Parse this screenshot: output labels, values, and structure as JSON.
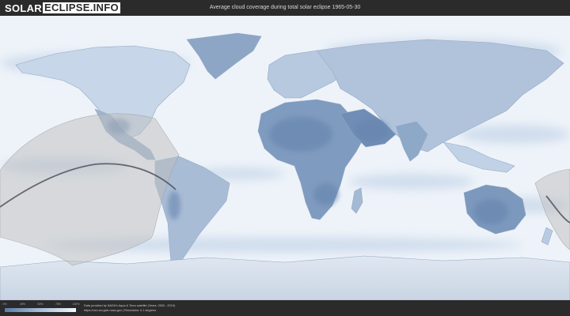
{
  "header": {
    "logo_solar": "SOLAR",
    "logo_eclipse": "ECLIPSE.INFO",
    "title": "Average cloud coverage during total solar eclipse 1965-05-30"
  },
  "legend": {
    "scale_ticks": [
      "0%",
      "25%",
      "50%",
      "75%",
      "100%"
    ],
    "gradient_colors": [
      "#5b7ca6",
      "#a8bfd8",
      "#f4f7fb"
    ]
  },
  "credits": {
    "line1": "Data provided by NASA's Aqua & Terra satellite (Years: 2000 - 2019)",
    "line2": "https://neo.sci.gsfc.nasa.gov | Resolution: 0.1 degrees"
  },
  "colors": {
    "background": "#2b2b2b",
    "ocean_cloud": "#eef3f9",
    "land_clear": "#7f9bbf",
    "eclipse_path": "#bdbdbd"
  }
}
